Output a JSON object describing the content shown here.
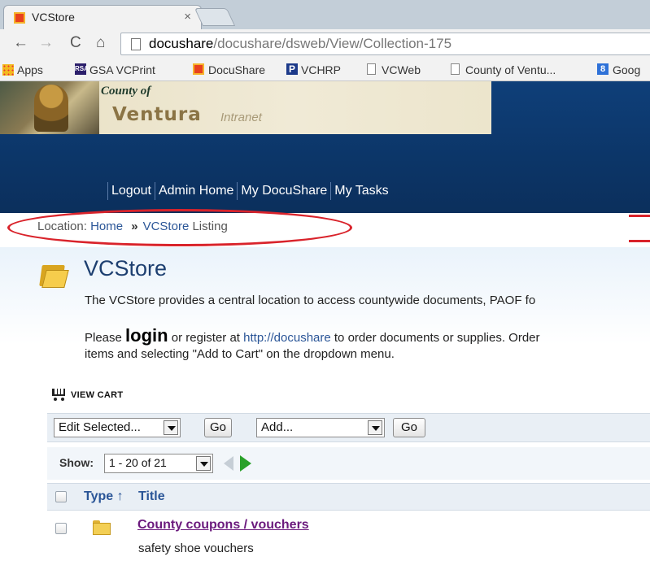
{
  "browser": {
    "tab_title": "VCStore",
    "tab_close": "×",
    "url_host": "docushare",
    "url_path": "/docushare/dsweb/View/Collection-175",
    "nav": {
      "back": "←",
      "forward": "→",
      "reload": "C",
      "home": "⌂"
    },
    "bookmarks": [
      {
        "label": "Apps",
        "icon": "apps-grid-icon"
      },
      {
        "label": "GSA VCPrint",
        "icon": "rsa-icon",
        "icon_text": "RSA"
      },
      {
        "label": "DocuShare",
        "icon": "docushare-icon"
      },
      {
        "label": "VCHRP",
        "icon": "p-icon",
        "icon_text": "P"
      },
      {
        "label": "VCWeb",
        "icon": "page-icon"
      },
      {
        "label": "County of Ventu...",
        "icon": "page-icon"
      },
      {
        "label": "Goog",
        "icon": "google-icon",
        "icon_text": "8"
      }
    ]
  },
  "banner": {
    "county": "County of",
    "ventura": "Ventura",
    "intranet": "Intranet"
  },
  "topnav": [
    "Logout",
    "Admin Home",
    "My DocuShare",
    "My Tasks"
  ],
  "breadcrumb": {
    "prefix": "Location:",
    "home": "Home",
    "separator": "»",
    "current_link": "VCStore",
    "suffix": "Listing"
  },
  "collection": {
    "title": "VCStore",
    "description_1": "The VCStore provides a central location to access countywide documents, PAOF fo",
    "please": "Please ",
    "login": "login",
    "register_text": " or register at ",
    "register_url": "http://docushare",
    "order_text": " to order documents or supplies.  Order",
    "description_3": "items and selecting \"Add to Cart\" on the dropdown menu."
  },
  "cart": {
    "label": "VIEW CART"
  },
  "actions": {
    "edit_selected": "Edit Selected...",
    "go": "Go",
    "add": "Add..."
  },
  "pager": {
    "show_label": "Show:",
    "range": "1 - 20 of 21"
  },
  "table": {
    "columns": {
      "type": "Type ↑",
      "title": "Title"
    },
    "rows": [
      {
        "title": "County coupons / vouchers",
        "description": "safety shoe vouchers",
        "icon": "folder-icon"
      }
    ]
  },
  "colors": {
    "header_blue": "#0e3f79",
    "link_blue": "#2a5597",
    "visited_purple": "#6b1a7d",
    "annotation_red": "#d9232b"
  }
}
